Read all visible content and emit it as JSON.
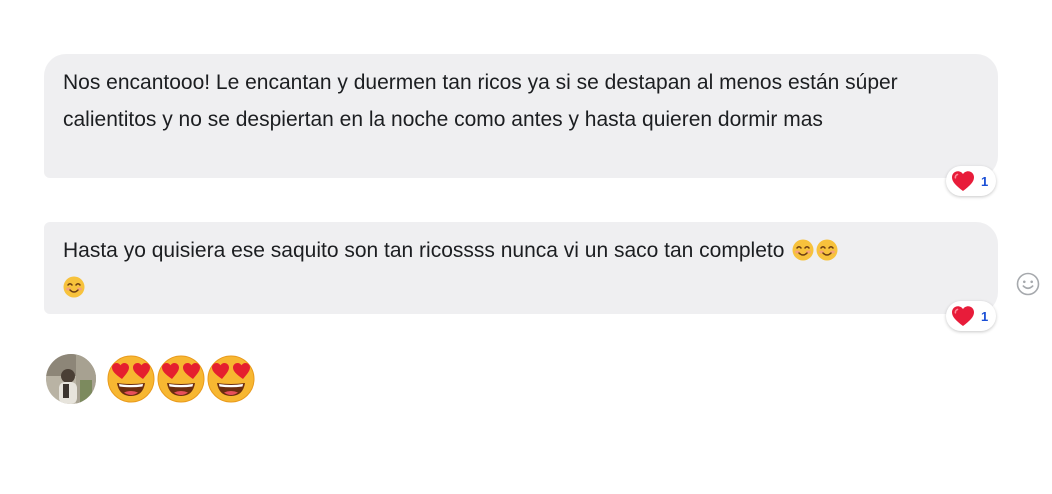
{
  "messages": [
    {
      "text": "Nos encantooo! Le encantan y duermen tan ricos ya si se destapan al menos están súper calientitos y no se despiertan en la noche como antes y hasta quieren dormir mas",
      "reaction": {
        "icon": "heart-icon",
        "count": "1"
      }
    },
    {
      "text": "Hasta yo quisiera ese saquito son tan ricossss nunca vi un saco tan completo",
      "inline_emojis": [
        "smiling-face-icon",
        "smiling-face-icon",
        "smiling-face-icon"
      ],
      "reaction": {
        "icon": "heart-icon",
        "count": "1"
      }
    }
  ],
  "reply": {
    "emojis": [
      "heart-eyes-icon",
      "heart-eyes-icon",
      "heart-eyes-icon"
    ]
  },
  "colors": {
    "bubble_bg": "#efeff1",
    "text": "#1c1e21",
    "reaction_count": "#1a4fd6",
    "heart": "#e81c3a"
  }
}
